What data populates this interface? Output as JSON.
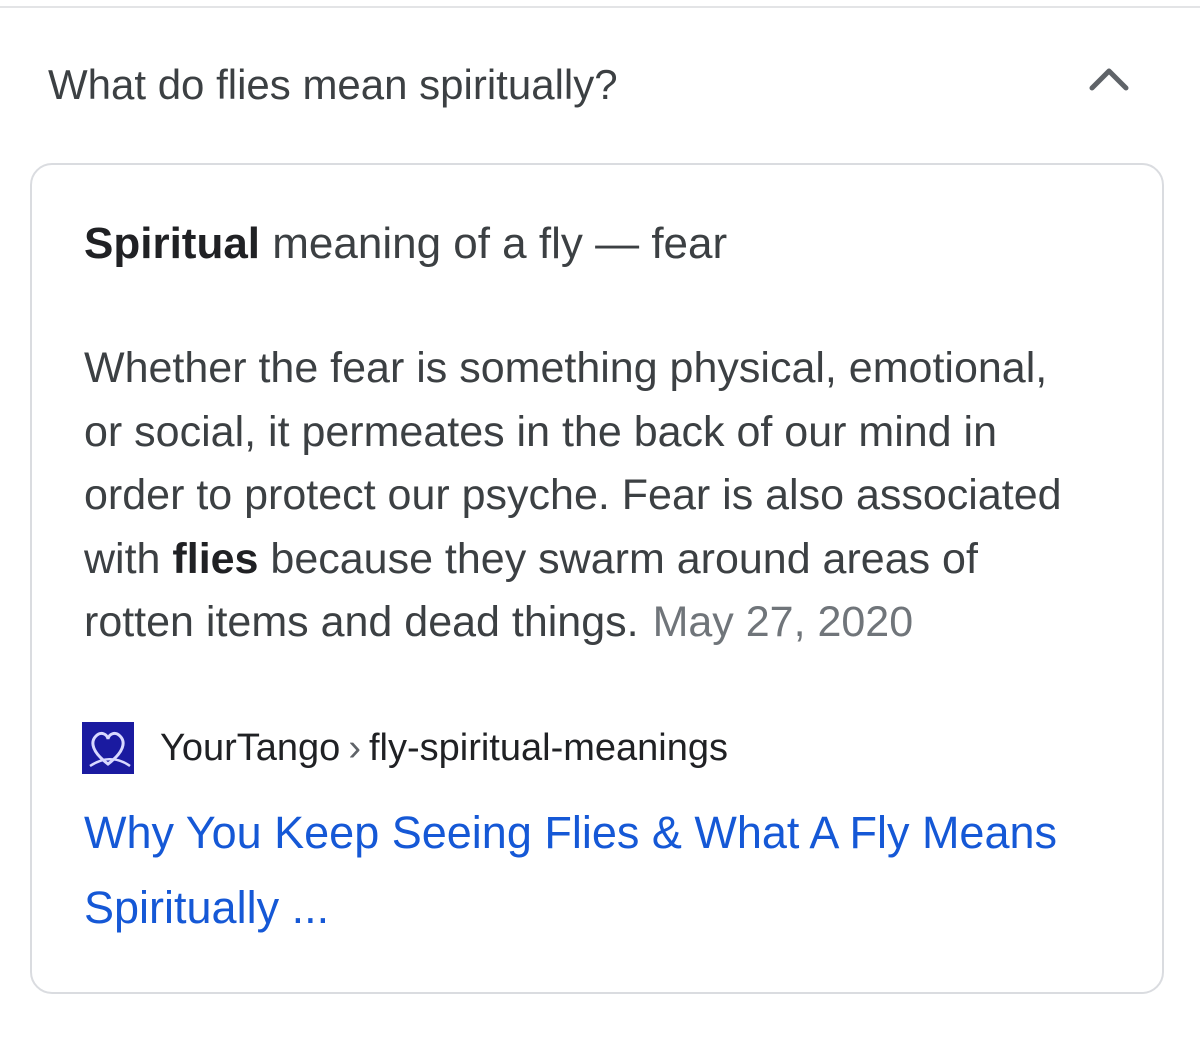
{
  "question": {
    "text": "What do flies mean spiritually?",
    "toggle_icon": "chevron-up-icon"
  },
  "answer": {
    "heading_bold": "Spiritual",
    "heading_rest": " meaning of a fly — fear",
    "body_line1": " Whether the fear is something physical, emotional,",
    "body_line2": "or social, it permeates in the back of our mind in",
    "body_line3": "order to protect our psyche. Fear is also associated",
    "body_line4_prefix": "with ",
    "body_line4_bold": "flies",
    "body_line4_suffix": " because they swarm around areas of",
    "body_line5": "rotten items and dead things.",
    "date": "May 27, 2020"
  },
  "source": {
    "favicon": "yourtango-heart-icon",
    "site": "YourTango",
    "separator": "›",
    "path": "fly-spiritual-meanings"
  },
  "result": {
    "title_line1": "Why You Keep Seeing Flies & What A Fly Means",
    "title_line2": "Spiritually ..."
  },
  "colors": {
    "link": "#1558d6",
    "text": "#3c4043",
    "muted": "#70757a",
    "border": "#dadce0",
    "favicon_bg": "#1a1aa0"
  }
}
